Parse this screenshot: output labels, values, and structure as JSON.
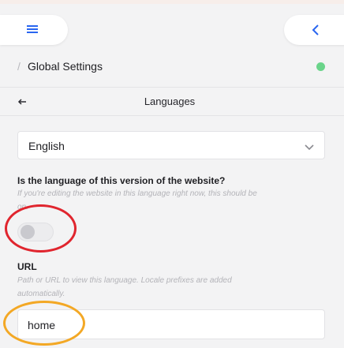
{
  "header": {
    "menu_icon": "hamburger-menu-icon",
    "back_icon": "chevron-left-icon",
    "accent_color": "#2a66f0"
  },
  "breadcrumb": {
    "separator": "/",
    "title": "Global Settings",
    "status_color": "#6ad48a"
  },
  "section": {
    "back_icon": "arrow-left-icon",
    "title": "Languages"
  },
  "language_select": {
    "value": "English",
    "icon": "chevron-down-icon"
  },
  "default_language": {
    "label": "Is the language of this version of the website?",
    "description": "If you're editing the website in this language right now, this should be",
    "description_overflow": "on.",
    "toggle_on": false
  },
  "url_field": {
    "label": "URL",
    "description": "Path or URL to view this language. Locale prefixes are added",
    "description_overflow": "automatically.",
    "value": "home"
  },
  "annotations": {
    "red_circle_color": "#e0252e",
    "orange_circle_color": "#f3a825"
  }
}
